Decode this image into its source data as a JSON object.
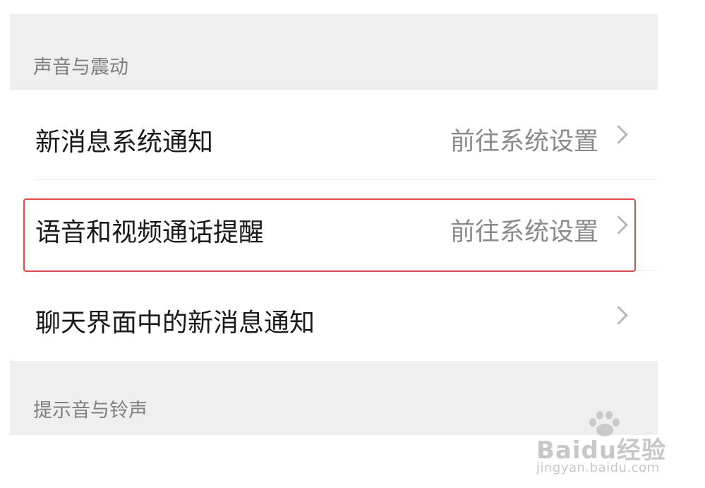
{
  "sections": {
    "sound_vibration": {
      "label": "声音与震动"
    },
    "tone_ringtone": {
      "label": "提示音与铃声"
    }
  },
  "rows": [
    {
      "title": "新消息系统通知",
      "value": "前往系统设置"
    },
    {
      "title": "语音和视频通话提醒",
      "value": "前往系统设置"
    },
    {
      "title": "聊天界面中的新消息通知",
      "value": ""
    }
  ],
  "watermark": {
    "brand": "Baidu经验",
    "url": "jingyan.baidu.com"
  },
  "colors": {
    "highlight": "#e04a4a",
    "section_bg": "#efefef"
  }
}
